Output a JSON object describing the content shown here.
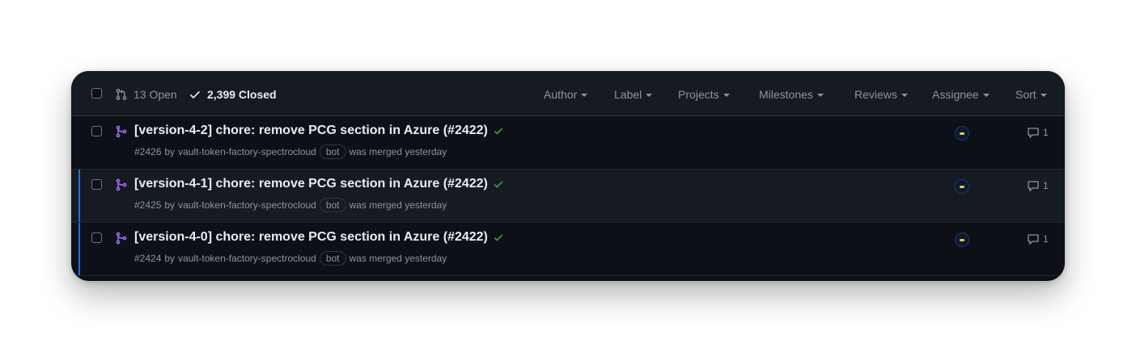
{
  "header": {
    "open_count": "13 Open",
    "closed_count": "2,399 Closed",
    "filters": [
      "Author",
      "Label",
      "Projects",
      "Milestones",
      "Reviews",
      "Assignee",
      "Sort"
    ]
  },
  "rows": [
    {
      "title": "[version-4-2] chore: remove PCG section in Azure (#2422)",
      "number": "#2426",
      "by": "by",
      "author": "vault-token-factory-spectrocloud",
      "badge": "bot",
      "status": "was merged yesterday",
      "comments": "1"
    },
    {
      "title": "[version-4-1] chore: remove PCG section in Azure (#2422)",
      "number": "#2425",
      "by": "by",
      "author": "vault-token-factory-spectrocloud",
      "badge": "bot",
      "status": "was merged yesterday",
      "comments": "1"
    },
    {
      "title": "[version-4-0] chore: remove PCG section in Azure (#2422)",
      "number": "#2424",
      "by": "by",
      "author": "vault-token-factory-spectrocloud",
      "badge": "bot",
      "status": "was merged yesterday",
      "comments": "1"
    }
  ],
  "colors": {
    "background": "#0d1117",
    "merged_icon": "#a371f7",
    "check": "#3fb950",
    "accent": "#1f6feb"
  },
  "icons": {
    "open": "git-pull-request-icon",
    "closed": "check-icon",
    "row": "git-merge-icon",
    "status": "check-icon",
    "comment": "comment-icon"
  }
}
